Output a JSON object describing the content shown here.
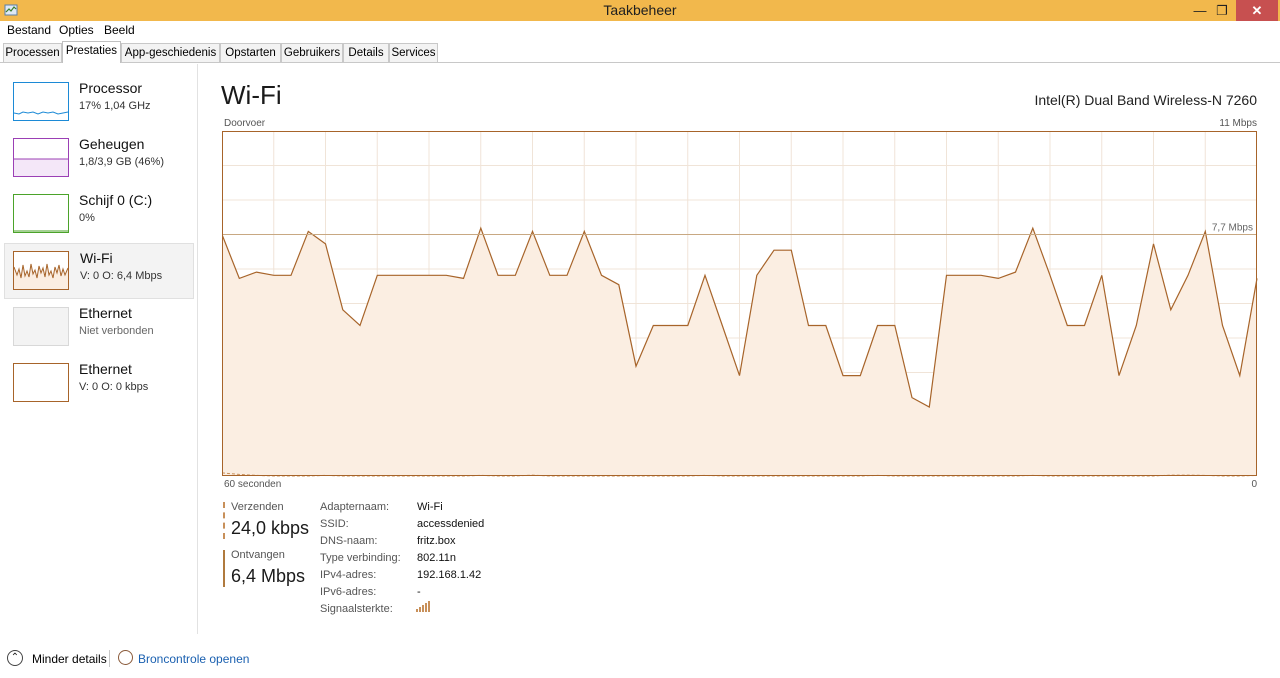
{
  "window": {
    "title": "Taakbeheer",
    "controls": {
      "minimize": "—",
      "maximize": "❐",
      "close": "✕"
    }
  },
  "menu": [
    "Bestand",
    "Opties",
    "Beeld"
  ],
  "tabs": [
    "Processen",
    "Prestaties",
    "App-geschiedenis",
    "Opstarten",
    "Gebruikers",
    "Details",
    "Services"
  ],
  "active_tab": "Prestaties",
  "sidebar": [
    {
      "name": "Processor",
      "sub": "17%  1,04 GHz",
      "color": "#1c8ad6",
      "selected": false
    },
    {
      "name": "Geheugen",
      "sub": "1,8/3,9 GB (46%)",
      "color": "#9b3fb5",
      "selected": false
    },
    {
      "name": "Schijf 0 (C:)",
      "sub": "0%",
      "color": "#4ba32a",
      "selected": false
    },
    {
      "name": "Wi-Fi",
      "sub": "V: 0  O: 6,4 Mbps",
      "color": "#a7642a",
      "selected": true
    },
    {
      "name": "Ethernet",
      "sub": "Niet verbonden",
      "color": "#c8c8c8",
      "selected": false
    },
    {
      "name": "Ethernet",
      "sub": "V: 0  O: 0 kbps",
      "color": "#a7642a",
      "selected": false
    }
  ],
  "main": {
    "title": "Wi-Fi",
    "adapter_model": "Intel(R) Dual Band Wireless-N 7260",
    "throughput_label": "Doorvoer",
    "max_label": "11 Mbps",
    "time_label": "60 seconden",
    "zero_label": "0"
  },
  "chart_data": {
    "type": "area",
    "ylim": [
      0,
      11
    ],
    "ylabel_unit": "Mbps",
    "reference_line": {
      "value": 7.7,
      "label": "7,7 Mbps"
    },
    "grid": true,
    "series": [
      {
        "role": "received",
        "color": "#a7642a",
        "fill": "#fbeee2",
        "x": [
          0,
          1,
          2,
          3,
          4,
          5,
          6,
          7,
          8,
          9,
          10,
          11,
          12,
          13,
          14,
          15,
          16,
          17,
          18,
          19,
          20,
          21,
          22,
          23,
          24,
          25,
          26,
          27,
          28,
          29,
          30,
          31,
          32,
          33,
          34,
          35,
          36,
          37,
          38,
          39,
          40,
          41,
          42,
          43,
          44,
          45,
          46,
          47,
          48,
          49,
          50,
          51,
          52,
          53,
          54,
          55,
          56,
          57,
          58,
          59,
          60
        ],
        "values": [
          7.7,
          6.3,
          6.5,
          6.4,
          6.4,
          7.8,
          7.4,
          5.3,
          4.8,
          6.4,
          6.4,
          6.4,
          6.4,
          6.4,
          6.3,
          7.9,
          6.4,
          6.4,
          7.8,
          6.4,
          6.4,
          7.8,
          6.4,
          6.1,
          3.5,
          4.8,
          4.8,
          4.8,
          6.4,
          4.8,
          3.2,
          6.4,
          7.2,
          7.2,
          4.8,
          4.8,
          3.2,
          3.2,
          4.8,
          4.8,
          2.5,
          2.2,
          6.4,
          6.4,
          6.4,
          6.3,
          6.5,
          7.9,
          6.4,
          4.8,
          4.8,
          6.4,
          3.2,
          4.8,
          7.4,
          5.3,
          6.4,
          7.8,
          4.8,
          3.2,
          6.3
        ]
      },
      {
        "role": "sent",
        "color": "#c8905a",
        "x": [
          0,
          1,
          2,
          3,
          4,
          5,
          6,
          7,
          8,
          9,
          10,
          11,
          12,
          13,
          14,
          15,
          16,
          17,
          18,
          19,
          20,
          21,
          22,
          23,
          24,
          25,
          26,
          27,
          28,
          29,
          30,
          31,
          32,
          33,
          34,
          35,
          36,
          37,
          38,
          39,
          40,
          41,
          42,
          43,
          44,
          45,
          46,
          47,
          48,
          49,
          50,
          51,
          52,
          53,
          54,
          55,
          56,
          57,
          58,
          59,
          60
        ],
        "values": [
          0.1,
          0.05,
          0.02,
          0.0,
          0.0,
          0.0,
          0.02,
          0.0,
          0.0,
          0.0,
          0.0,
          0.0,
          0.0,
          0.0,
          0.0,
          0.02,
          0.0,
          0.0,
          0.03,
          0.0,
          0.0,
          0.0,
          0.0,
          0.0,
          0.0,
          0.0,
          0.0,
          0.0,
          0.02,
          0.0,
          0.0,
          0.0,
          0.0,
          0.0,
          0.0,
          0.0,
          0.0,
          0.0,
          0.02,
          0.0,
          0.0,
          0.0,
          0.0,
          0.0,
          0.0,
          0.0,
          0.0,
          0.02,
          0.0,
          0.0,
          0.0,
          0.0,
          0.0,
          0.0,
          0.0,
          0.03,
          0.03,
          0.02,
          0.0,
          0.0,
          0.02
        ]
      }
    ]
  },
  "stats": {
    "send_label": "Verzenden",
    "send_value": "24,0 kbps",
    "recv_label": "Ontvangen",
    "recv_value": "6,4 Mbps",
    "send_color": "#c8905a",
    "recv_color": "#b07a3e"
  },
  "properties": [
    {
      "label": "Adapternaam:",
      "value": "Wi-Fi"
    },
    {
      "label": "SSID:",
      "value": "accessdenied"
    },
    {
      "label": "DNS-naam:",
      "value": "fritz.box"
    },
    {
      "label": "Type verbinding:",
      "value": "802.11n"
    },
    {
      "label": "IPv4-adres:",
      "value": "192.168.1.42"
    },
    {
      "label": "IPv6-adres:",
      "value": "-"
    },
    {
      "label": "Signaalsterkte:",
      "value": ""
    }
  ],
  "signal_icon": "signal-strength-bars",
  "footer": {
    "fewer_details": "Minder details",
    "resource_monitor": "Broncontrole openen"
  }
}
